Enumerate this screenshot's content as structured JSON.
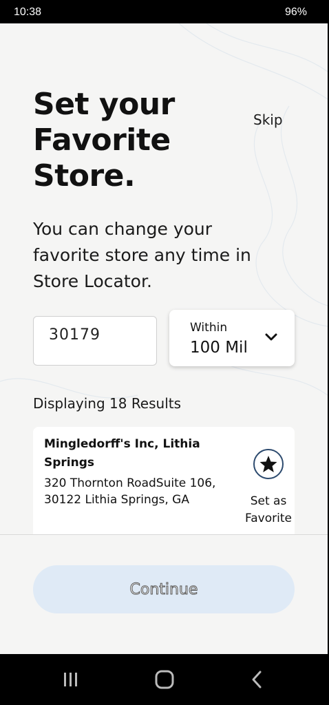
{
  "status_bar": {
    "time": "10:38",
    "battery": "96%"
  },
  "header": {
    "title_lines": [
      "Set your",
      "Favorite",
      "Store."
    ],
    "skip_label": "Skip"
  },
  "subtitle_lines": [
    "You can change your",
    "favorite store any time in",
    "Store Locator."
  ],
  "search": {
    "zip_value": "30179",
    "radius_label": "Within",
    "radius_value": "100 Mil"
  },
  "results": {
    "count_text": "Displaying 18 Results",
    "stores": [
      {
        "name": "Mingledorff's Inc, Lithia Springs",
        "address": "320 Thornton RoadSuite 106, 30122 Lithia Springs, GA",
        "favorite_label": "Set as Favorite"
      }
    ]
  },
  "footer": {
    "continue_label": "Continue"
  },
  "colors": {
    "accent_light": "#dfeaf6",
    "icon_ring": "#2c4a6e",
    "background": "#f5f5f4"
  },
  "icons": {
    "favorite": "star-icon",
    "dropdown": "chevron-down-icon",
    "nav_recents": "recents-icon",
    "nav_home": "home-icon",
    "nav_back": "back-icon"
  }
}
